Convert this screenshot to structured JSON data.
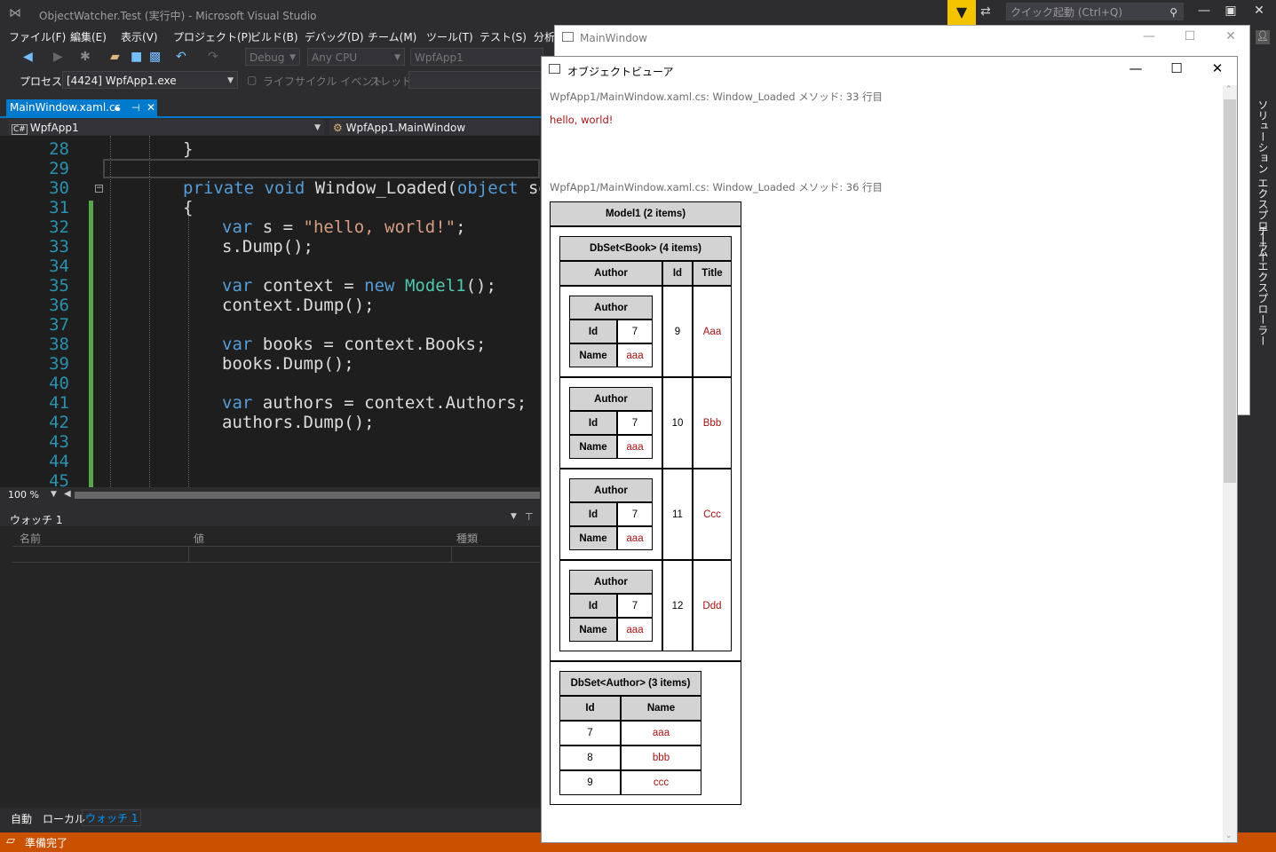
{
  "vs": {
    "title": "ObjectWatcher.Test (実行中) - Microsoft Visual Studio",
    "quick_launch": "クイック起動 (Ctrl+Q)",
    "menu": [
      "ファイル(F)",
      "編集(E)",
      "表示(V)",
      "プロジェクト(P)",
      "ビルド(B)",
      "デバッグ(D)",
      "チーム(M)",
      "ツール(T)",
      "テスト(S)",
      "分析"
    ],
    "toolbar": {
      "config": "Debug",
      "platform": "Any CPU",
      "startup": "WpfApp1"
    },
    "process": {
      "label": "プロセス:",
      "value": "[4424] WpfApp1.exe",
      "lifecycle": "ライフサイクル イベント",
      "thread": "スレッド:"
    },
    "doc_tab": "MainWindow.xaml.cs",
    "nav": {
      "project": "WpfApp1",
      "class": "WpfApp1.MainWindow"
    },
    "code": {
      "line_numbers": [
        "28",
        "29",
        "30",
        "31",
        "32",
        "33",
        "34",
        "35",
        "36",
        "37",
        "38",
        "39",
        "40",
        "41",
        "42",
        "43",
        "44",
        "45"
      ],
      "l28": "}",
      "l30_kw1": "private",
      "l30_kw2": "void",
      "l30_name": " Window_Loaded(",
      "l30_kw3": "object",
      "l30_rest": " ser",
      "l31": "{",
      "l32_kw": "var",
      "l32_a": " s = ",
      "l32_str": "\"hello, world!\"",
      "l32_b": ";",
      "l33": "s.Dump();",
      "l35_kw": "var",
      "l35_a": " context = ",
      "l35_kw2": "new",
      "l35_typ": " Model1",
      "l35_b": "();",
      "l36": "context.Dump();",
      "l38_kw": "var",
      "l38_a": " books = context.Books;",
      "l39": "books.Dump();",
      "l41_kw": "var",
      "l41_a": " authors = context.Authors;",
      "l42": "authors.Dump();"
    },
    "zoom": "100 %",
    "watch": {
      "title": "ウォッチ 1",
      "cols": [
        "名前",
        "値",
        "種類"
      ]
    },
    "bottom_tabs": [
      "自動",
      "ローカル",
      "ウォッチ 1"
    ],
    "status": "準備完了",
    "right_strip": [
      "ソリューション エクスプローラー",
      "チーム エクスプローラー"
    ]
  },
  "mainwindow": {
    "title": "MainWindow"
  },
  "viewer": {
    "title": "オブジェクトビューア",
    "src1": "WpfApp1/MainWindow.xaml.cs: Window_Loaded メソッド: 33 行目",
    "hello": "hello, world!",
    "src2": "WpfApp1/MainWindow.xaml.cs: Window_Loaded メソッド: 36 行目",
    "model": {
      "header": "Model1 (2 items)",
      "books_header": "DbSet<Book> (4 items)",
      "books_cols": [
        "Author",
        "Id",
        "Title"
      ],
      "author_label": "Author",
      "id_label": "Id",
      "name_label": "Name",
      "books": [
        {
          "author_id": "7",
          "author_name": "aaa",
          "id": "9",
          "title": "Aaa"
        },
        {
          "author_id": "7",
          "author_name": "aaa",
          "id": "10",
          "title": "Bbb"
        },
        {
          "author_id": "7",
          "author_name": "aaa",
          "id": "11",
          "title": "Ccc"
        },
        {
          "author_id": "7",
          "author_name": "aaa",
          "id": "12",
          "title": "Ddd"
        }
      ],
      "authors_header": "DbSet<Author> (3 items)",
      "authors_cols": [
        "Id",
        "Name"
      ],
      "authors": [
        {
          "id": "7",
          "name": "aaa"
        },
        {
          "id": "8",
          "name": "bbb"
        },
        {
          "id": "9",
          "name": "ccc"
        }
      ]
    }
  },
  "colors": {
    "accent": "#007acc",
    "status_bar": "#ca5100",
    "filter": "#f5c400",
    "value_text": "#a31515",
    "header_cell": "#d3d3d3"
  }
}
